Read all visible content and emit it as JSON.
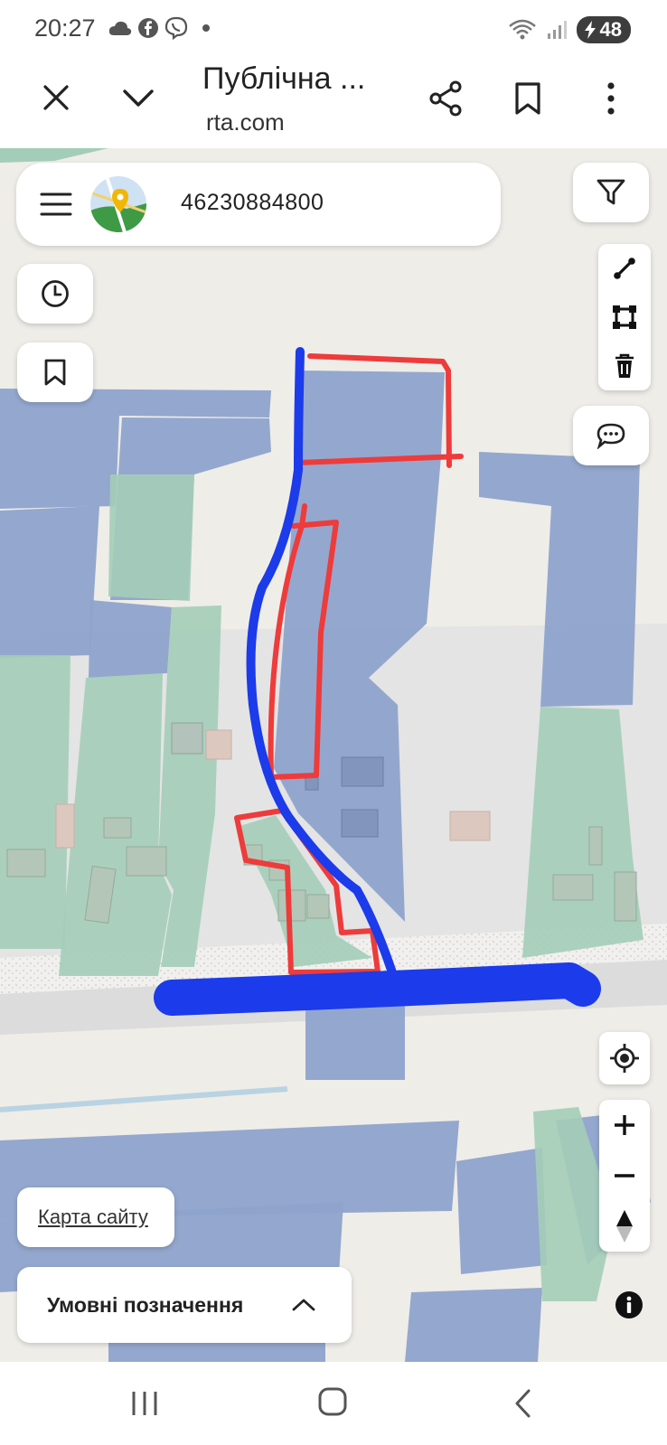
{
  "status_bar": {
    "time": "20:27",
    "icons": [
      "cloud-icon",
      "facebook-icon",
      "viber-icon",
      "dot-icon"
    ],
    "battery": "48"
  },
  "browser": {
    "title": "Публічна ...",
    "url": "rta.com"
  },
  "search": {
    "query": "46230884800"
  },
  "buttons": {
    "site_map": "Карта сайту",
    "legend": "Умовні позначення"
  },
  "colors": {
    "parcel_blue": "#8ea3cc",
    "parcel_green": "#a3cdb8",
    "annotation_red": "#ee3b3b",
    "annotation_blue": "#1c3bea",
    "map_background": "#efede8"
  }
}
